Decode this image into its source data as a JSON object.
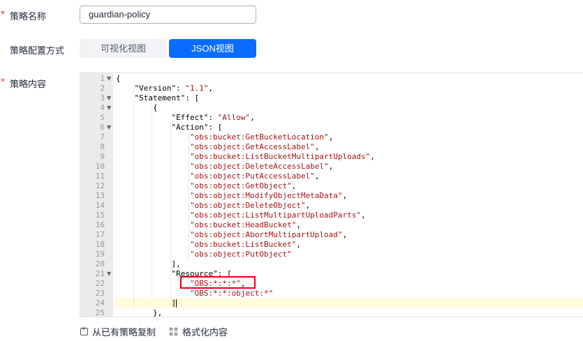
{
  "form": {
    "name_label": "策略名称",
    "name_value": "guardian-policy",
    "mode_label": "策略配置方式",
    "mode_options": [
      "可视化视图",
      "JSON视图"
    ],
    "mode_selected": "JSON视图",
    "content_label": "策略内容",
    "required_mark": "*"
  },
  "editor": {
    "active_line": 24,
    "lines": [
      {
        "n": "1",
        "fold": true,
        "indent": 0,
        "tokens": [
          [
            "punc",
            "{"
          ]
        ]
      },
      {
        "n": "2",
        "fold": false,
        "indent": 1,
        "tokens": [
          [
            "key",
            "\"Version\": "
          ],
          [
            "str",
            "\"1.1\""
          ],
          [
            "punc",
            ","
          ]
        ]
      },
      {
        "n": "3",
        "fold": true,
        "indent": 1,
        "tokens": [
          [
            "key",
            "\"Statement\": ["
          ]
        ]
      },
      {
        "n": "4",
        "fold": true,
        "indent": 2,
        "tokens": [
          [
            "punc",
            "{"
          ]
        ]
      },
      {
        "n": "5",
        "fold": false,
        "indent": 3,
        "tokens": [
          [
            "key",
            "\"Effect\": "
          ],
          [
            "str",
            "\"Allow\""
          ],
          [
            "punc",
            ","
          ]
        ]
      },
      {
        "n": "6",
        "fold": true,
        "indent": 3,
        "tokens": [
          [
            "key",
            "\"Action\": ["
          ]
        ]
      },
      {
        "n": "7",
        "fold": false,
        "indent": 4,
        "tokens": [
          [
            "str",
            "\"obs:bucket:GetBucketLocation\""
          ],
          [
            "punc",
            ","
          ]
        ]
      },
      {
        "n": "8",
        "fold": false,
        "indent": 4,
        "tokens": [
          [
            "str",
            "\"obs:object:GetAccessLabel\""
          ],
          [
            "punc",
            ","
          ]
        ]
      },
      {
        "n": "9",
        "fold": false,
        "indent": 4,
        "tokens": [
          [
            "str",
            "\"obs:bucket:ListBucketMultipartUploads\""
          ],
          [
            "punc",
            ","
          ]
        ]
      },
      {
        "n": "10",
        "fold": false,
        "indent": 4,
        "tokens": [
          [
            "str",
            "\"obs:object:DeleteAccessLabel\""
          ],
          [
            "punc",
            ","
          ]
        ]
      },
      {
        "n": "11",
        "fold": false,
        "indent": 4,
        "tokens": [
          [
            "str",
            "\"obs:object:PutAccessLabel\""
          ],
          [
            "punc",
            ","
          ]
        ]
      },
      {
        "n": "12",
        "fold": false,
        "indent": 4,
        "tokens": [
          [
            "str",
            "\"obs:object:GetObject\""
          ],
          [
            "punc",
            ","
          ]
        ]
      },
      {
        "n": "13",
        "fold": false,
        "indent": 4,
        "tokens": [
          [
            "str",
            "\"obs:object:ModifyObjectMetaData\""
          ],
          [
            "punc",
            ","
          ]
        ]
      },
      {
        "n": "14",
        "fold": false,
        "indent": 4,
        "tokens": [
          [
            "str",
            "\"obs:object:DeleteObject\""
          ],
          [
            "punc",
            ","
          ]
        ]
      },
      {
        "n": "15",
        "fold": false,
        "indent": 4,
        "tokens": [
          [
            "str",
            "\"obs:object:ListMultipartUploadParts\""
          ],
          [
            "punc",
            ","
          ]
        ]
      },
      {
        "n": "16",
        "fold": false,
        "indent": 4,
        "tokens": [
          [
            "str",
            "\"obs:bucket:HeadBucket\""
          ],
          [
            "punc",
            ","
          ]
        ]
      },
      {
        "n": "17",
        "fold": false,
        "indent": 4,
        "tokens": [
          [
            "str",
            "\"obs:object:AbortMultipartUpload\""
          ],
          [
            "punc",
            ","
          ]
        ]
      },
      {
        "n": "18",
        "fold": false,
        "indent": 4,
        "tokens": [
          [
            "str",
            "\"obs:bucket:ListBucket\""
          ],
          [
            "punc",
            ","
          ]
        ]
      },
      {
        "n": "19",
        "fold": false,
        "indent": 4,
        "tokens": [
          [
            "str",
            "\"obs:object:PutObject\""
          ]
        ]
      },
      {
        "n": "20",
        "fold": false,
        "indent": 3,
        "tokens": [
          [
            "punc",
            "],"
          ]
        ]
      },
      {
        "n": "21",
        "fold": true,
        "indent": 3,
        "tokens": [
          [
            "key",
            "\"Resource\": ["
          ]
        ]
      },
      {
        "n": "22",
        "fold": false,
        "indent": 4,
        "tokens": [
          [
            "str",
            "\"OBS:*:*:*\""
          ],
          [
            "punc",
            ","
          ]
        ]
      },
      {
        "n": "23",
        "fold": false,
        "indent": 4,
        "tokens": [
          [
            "str",
            "\"OBS:*:*:object:*\""
          ]
        ]
      },
      {
        "n": "24",
        "fold": false,
        "indent": 3,
        "tokens": [
          [
            "punc",
            "]"
          ]
        ]
      },
      {
        "n": "25",
        "fold": false,
        "indent": 2,
        "tokens": [
          [
            "punc",
            "},"
          ]
        ]
      }
    ]
  },
  "footer": {
    "copy_label": "从已有策略复制",
    "format_label": "格式化内容"
  },
  "colors": {
    "accent": "#0a6cff",
    "string": "#a31515",
    "required": "#e54545",
    "highlight_box": "#e1001b"
  }
}
